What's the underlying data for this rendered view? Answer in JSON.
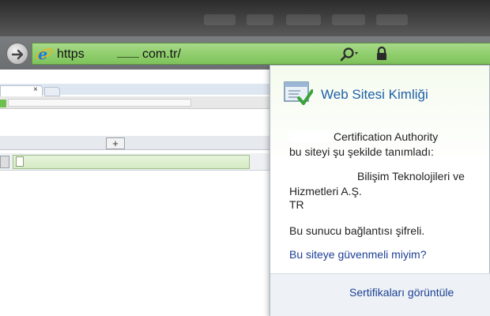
{
  "address_bar": {
    "protocol": "https",
    "domain_suffix": "com.tr/",
    "bar_color": "#8fcd6c"
  },
  "icons": {
    "back": "back-arrow-icon",
    "forward": "forward-arrow-icon",
    "browser": "internet-explorer-icon",
    "search": "search-icon",
    "lock": "lock-icon",
    "certificate": "certificate-icon"
  },
  "background_window": {
    "tab_close_glyph": "×",
    "new_tab_glyph": "+"
  },
  "identity_popup": {
    "title": "Web Sitesi Kimliği",
    "issuer_line": "Certification Authority",
    "identified_text": "bu siteyi şu şekilde tanımladı:",
    "org_line1": "Bilişim Teknolojileri  ve",
    "org_line2": "Hizmetleri A.Ş.",
    "country": "TR",
    "encrypted_text": "Bu sunucu bağlantısı şifreli.",
    "trust_link": "Bu siteye güvenmeli miyim?",
    "view_certificates": "Sertifikaları görüntüle",
    "title_color": "#1f5fa8",
    "link_color": "#1c3f94"
  }
}
